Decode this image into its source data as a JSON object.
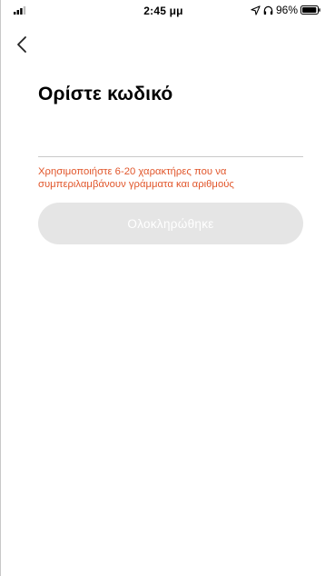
{
  "status_bar": {
    "time": "2:45 μμ",
    "battery_percent": "96%",
    "signal_icon": "signal-bars-icon",
    "location_icon": "location-arrow-icon",
    "headphones_icon": "headphones-icon",
    "battery_icon": "battery-icon",
    "battery_level": 0.96
  },
  "navigation": {
    "back_icon": "chevron-left-icon"
  },
  "page": {
    "title": "Ορίστε κωδικό"
  },
  "password_input": {
    "value": "",
    "placeholder": ""
  },
  "hint": {
    "text": "Χρησιμοποιήστε 6-20 χαρακτήρες που να συμπεριλαμβάνουν γράμματα και αριθμούς",
    "color": "#e1562b"
  },
  "done_button": {
    "label": "Ολοκληρώθηκε",
    "enabled": false,
    "background": "#e5e5e5"
  }
}
